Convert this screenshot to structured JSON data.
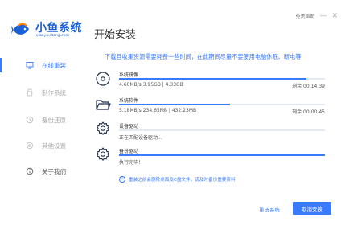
{
  "brand": {
    "name": "小鱼系统",
    "url": "xiaoyuxitong.com",
    "color": "#1a5fd6"
  },
  "page": {
    "title": "开始安装"
  },
  "topbar": {
    "disclaimer": "免责声明",
    "minimize": "—",
    "close": "✕"
  },
  "sidebar": {
    "items": [
      {
        "label": "在线重装",
        "icon": "monitor-icon",
        "active": true
      },
      {
        "label": "制作系统",
        "icon": "usb-icon"
      },
      {
        "label": "备份还原",
        "icon": "backup-restore-icon"
      },
      {
        "label": "其他设置",
        "icon": "settings-icon"
      },
      {
        "label": "关于我们",
        "icon": "info-icon"
      }
    ]
  },
  "notice": "下载且收集资源需要耗费一些时间，在此期间尽量不要使用电脑休眠、断电等",
  "tasks": [
    {
      "name": "系统镜像",
      "info": "4.60MB/s 3.95GB | 4.33GB",
      "remaining": "剩余 00:14:39",
      "progress": 0.91,
      "icon": "disc-icon"
    },
    {
      "name": "系统软件",
      "info": "5.18MB/s 234.65MB | 432.23MB",
      "remaining": "剩余 00:00:45",
      "progress": 0.54,
      "icon": "folder-icon"
    },
    {
      "name": "设备驱动",
      "info": "正在匹配设备驱动...",
      "remaining": "",
      "progress": 0,
      "icon": "gear-icon"
    },
    {
      "name": "备份驱动",
      "info": "执行完毕！",
      "remaining": "",
      "progress": 1.0,
      "icon": "gear-icon"
    }
  ],
  "tip": {
    "icon": "!",
    "text": "重装之前会删除桌面及C盘文件，请及时备份重要资料"
  },
  "buttons": {
    "reselect": "重选系统",
    "cancel": "取消安装"
  },
  "accent_color": "#3a7bfd"
}
